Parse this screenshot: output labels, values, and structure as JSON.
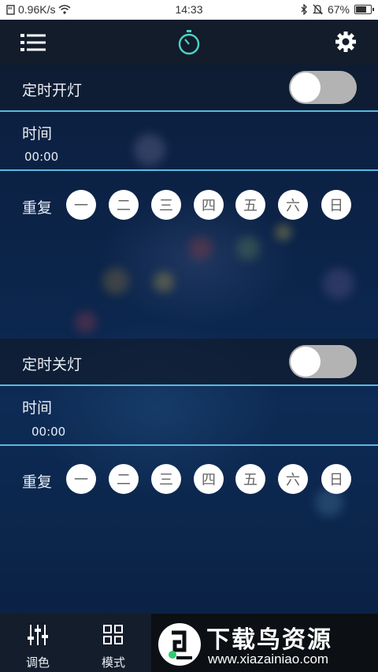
{
  "status_bar": {
    "speed": "0.96K/s",
    "time": "14:33",
    "battery": "67%"
  },
  "header": {
    "menu_icon": "list-menu-icon",
    "center_icon": "stopwatch-icon",
    "settings_icon": "gear-icon"
  },
  "on_timer": {
    "title": "定时开灯",
    "enabled": false,
    "time_label": "时间",
    "time_value": "00:00",
    "repeat_label": "重复",
    "days": [
      "一",
      "二",
      "三",
      "四",
      "五",
      "六",
      "日"
    ]
  },
  "off_timer": {
    "title": "定时关灯",
    "enabled": false,
    "time_label": "时间",
    "time_value": "00:00",
    "repeat_label": "重复",
    "days": [
      "一",
      "二",
      "三",
      "四",
      "五",
      "六",
      "日"
    ]
  },
  "bottom_nav": {
    "items": [
      {
        "label": "调色",
        "icon": "sliders-icon"
      },
      {
        "label": "模式",
        "icon": "grid-icon"
      }
    ]
  },
  "watermark": {
    "title": "下载鸟资源",
    "url": "www.xiazainiao.com"
  },
  "colors": {
    "accent": "#5ab8e0",
    "timer_icon": "#4fd1c5",
    "toggle_off": "#b3b3b3",
    "header_bg": "#121c2b"
  }
}
